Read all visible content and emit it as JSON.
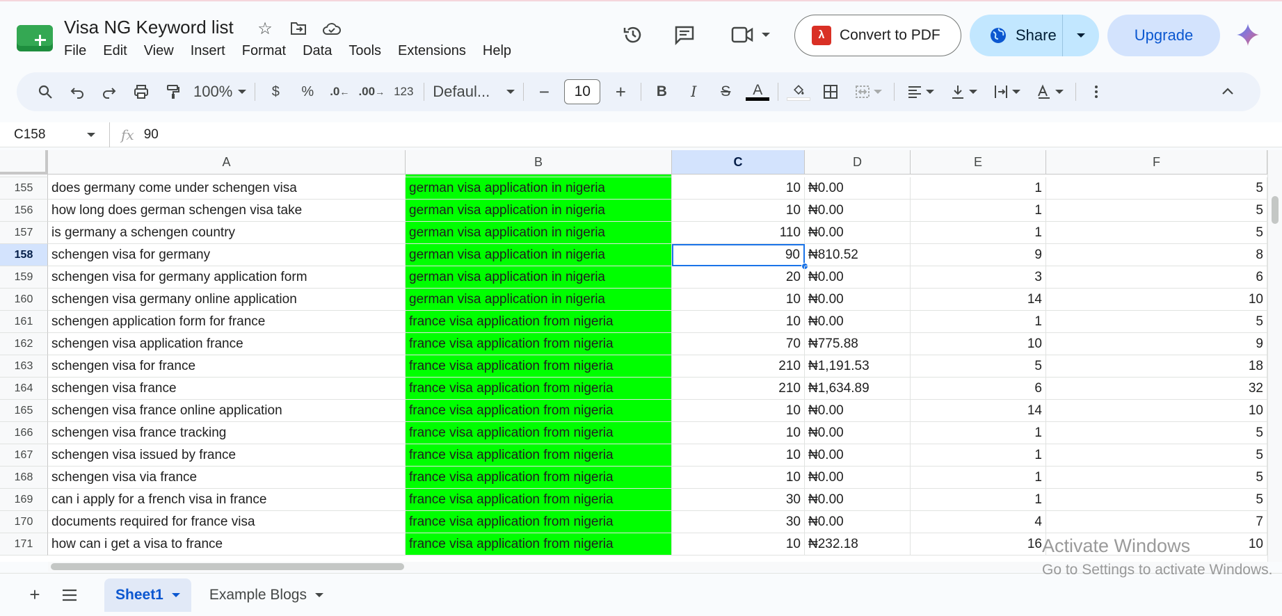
{
  "app": {
    "title": "Visa NG Keyword list",
    "menu": [
      "File",
      "Edit",
      "View",
      "Insert",
      "Format",
      "Data",
      "Tools",
      "Extensions",
      "Help"
    ],
    "convert_label": "Convert to PDF",
    "share_label": "Share",
    "upgrade_label": "Upgrade",
    "accent": "#0b57d0"
  },
  "toolbar": {
    "zoom": "100%",
    "currency": "$",
    "percent": "%",
    "dec_decrease": ".0",
    "dec_increase": ".00",
    "format_123": "123",
    "font": "Defaul...",
    "font_size": "10",
    "minus": "−",
    "plus": "+",
    "bold": "B",
    "italic": "I",
    "strike": "S",
    "text_color": "A"
  },
  "formula_bar": {
    "cell_ref": "C158",
    "fx": "fx",
    "value": "90"
  },
  "columns": [
    "A",
    "B",
    "C",
    "D",
    "E",
    "F"
  ],
  "selected_column": "C",
  "rows": [
    {
      "n": "155",
      "a": "does germany come under schengen visa",
      "b": "german visa application in nigeria",
      "c": "10",
      "d": "₦0.00",
      "e": "1",
      "f": "5"
    },
    {
      "n": "156",
      "a": "how long does german schengen visa take",
      "b": "german visa application in nigeria",
      "c": "10",
      "d": "₦0.00",
      "e": "1",
      "f": "5"
    },
    {
      "n": "157",
      "a": "is germany a schengen country",
      "b": "german visa application in nigeria",
      "c": "110",
      "d": "₦0.00",
      "e": "1",
      "f": "5"
    },
    {
      "n": "158",
      "a": "schengen visa for germany",
      "b": "german visa application in nigeria",
      "c": "90",
      "d": "₦810.52",
      "e": "9",
      "f": "8"
    },
    {
      "n": "159",
      "a": "schengen visa for germany application form",
      "b": "german visa application in nigeria",
      "c": "20",
      "d": "₦0.00",
      "e": "3",
      "f": "6"
    },
    {
      "n": "160",
      "a": "schengen visa germany online application",
      "b": "german visa application in nigeria",
      "c": "10",
      "d": "₦0.00",
      "e": "14",
      "f": "10"
    },
    {
      "n": "161",
      "a": "schengen application form for france",
      "b": "france visa application from nigeria",
      "c": "10",
      "d": "₦0.00",
      "e": "1",
      "f": "5"
    },
    {
      "n": "162",
      "a": "schengen visa application france",
      "b": "france visa application from nigeria",
      "c": "70",
      "d": "₦775.88",
      "e": "10",
      "f": "9"
    },
    {
      "n": "163",
      "a": "schengen visa for france",
      "b": "france visa application from nigeria",
      "c": "210",
      "d": "₦1,191.53",
      "e": "5",
      "f": "18"
    },
    {
      "n": "164",
      "a": "schengen visa france",
      "b": "france visa application from nigeria",
      "c": "210",
      "d": "₦1,634.89",
      "e": "6",
      "f": "32"
    },
    {
      "n": "165",
      "a": "schengen visa france online application",
      "b": "france visa application from nigeria",
      "c": "10",
      "d": "₦0.00",
      "e": "14",
      "f": "10"
    },
    {
      "n": "166",
      "a": "schengen visa france tracking",
      "b": "france visa application from nigeria",
      "c": "10",
      "d": "₦0.00",
      "e": "1",
      "f": "5"
    },
    {
      "n": "167",
      "a": "schengen visa issued by france",
      "b": "france visa application from nigeria",
      "c": "10",
      "d": "₦0.00",
      "e": "1",
      "f": "5"
    },
    {
      "n": "168",
      "a": "schengen visa via france",
      "b": "france visa application from nigeria",
      "c": "10",
      "d": "₦0.00",
      "e": "1",
      "f": "5"
    },
    {
      "n": "169",
      "a": "can i apply for a french visa in france",
      "b": "france visa application from nigeria",
      "c": "30",
      "d": "₦0.00",
      "e": "1",
      "f": "5"
    },
    {
      "n": "170",
      "a": "documents required for france visa",
      "b": "france visa application from nigeria",
      "c": "30",
      "d": "₦0.00",
      "e": "4",
      "f": "7"
    },
    {
      "n": "171",
      "a": "how can i get a visa to france",
      "b": "france visa application from nigeria",
      "c": "10",
      "d": "₦232.18",
      "e": "16",
      "f": "10"
    }
  ],
  "active_cell": {
    "row": "158",
    "col": "C"
  },
  "highlight_color": "#00ff00",
  "sheets": [
    {
      "label": "Sheet1",
      "active": true
    },
    {
      "label": "Example Blogs",
      "active": false
    }
  ],
  "watermark": {
    "line1": "Activate Windows",
    "line2": "Go to Settings to activate Windows."
  }
}
